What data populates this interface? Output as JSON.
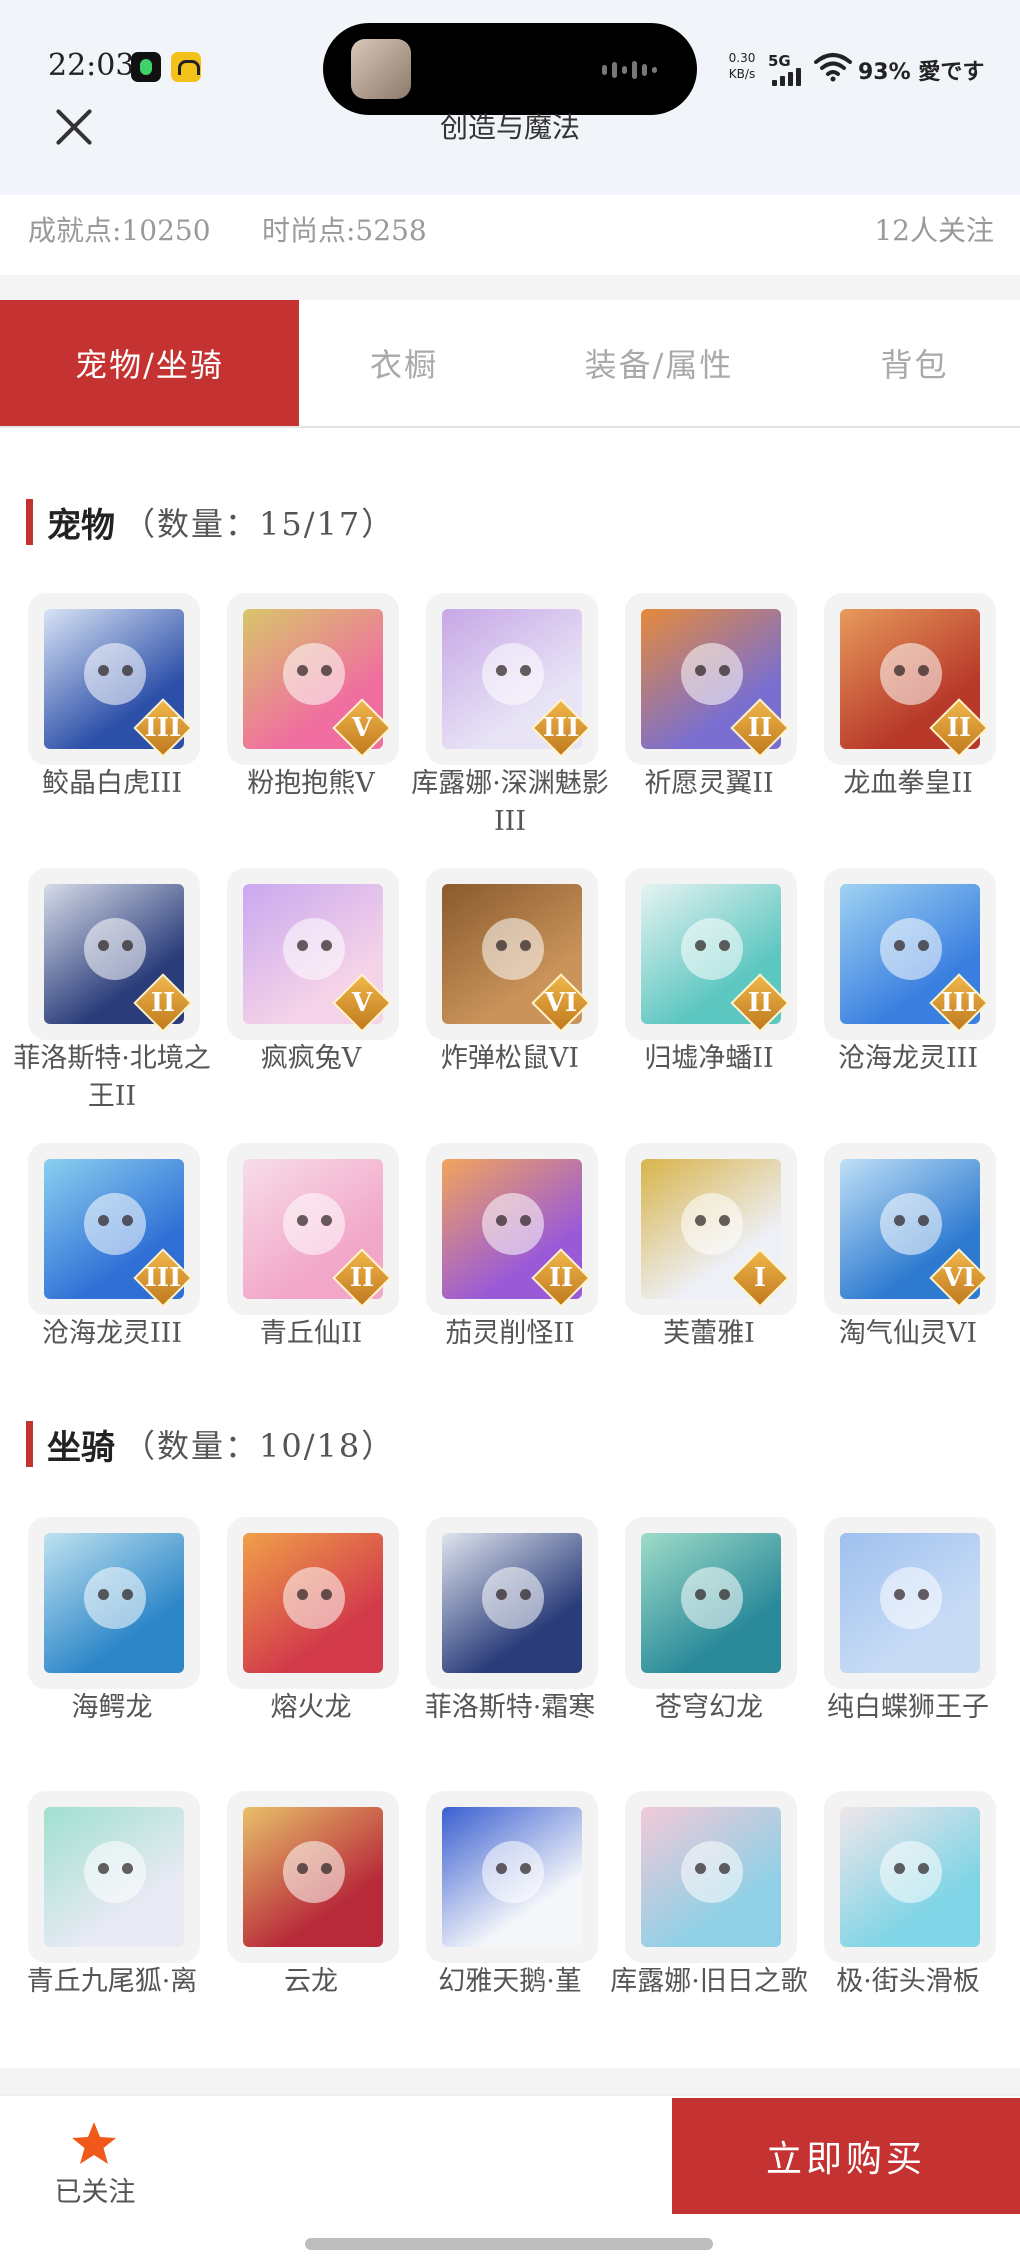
{
  "status_bar": {
    "time": "22:03",
    "net_speed": "0.30 KB/s",
    "network": "5G",
    "battery": "93%",
    "carrier": "愛です"
  },
  "nav": {
    "title": "创造与魔法"
  },
  "stats": {
    "achievement": "成就点:10250",
    "fashion": "时尚点:5258",
    "followers": "12人关注"
  },
  "tabs": [
    {
      "label": "宠物/坐骑",
      "active": true
    },
    {
      "label": "衣橱",
      "active": false
    },
    {
      "label": "装备/属性",
      "active": false
    },
    {
      "label": "背包",
      "active": false
    }
  ],
  "pets": {
    "title": "宠物",
    "count": "（数量：15/17）",
    "items": [
      {
        "name": "鲛晶白虎III",
        "tier": "III",
        "color1": "#2c4fa8",
        "color2": "#d8e3f5"
      },
      {
        "name": "粉抱抱熊V",
        "tier": "V",
        "color1": "#f06da0",
        "color2": "#d8c66a"
      },
      {
        "name": "库露娜·深渊魅影III",
        "tier": "III",
        "color1": "#e8e4f6",
        "color2": "#c7a7e6"
      },
      {
        "name": "祈愿灵翼II",
        "tier": "II",
        "color1": "#7a6fd0",
        "color2": "#e68a3a"
      },
      {
        "name": "龙血拳皇II",
        "tier": "II",
        "color1": "#b8392a",
        "color2": "#e79a5c"
      },
      {
        "name": "菲洛斯特·北境之王II",
        "tier": "II",
        "color1": "#2a3c7a",
        "color2": "#d6dbe8"
      },
      {
        "name": "疯疯兔V",
        "tier": "V",
        "color1": "#f4d2e8",
        "color2": "#c9a8f0"
      },
      {
        "name": "炸弹松鼠VI",
        "tier": "VI",
        "color1": "#c9935a",
        "color2": "#8a5a2e"
      },
      {
        "name": "归墟净蟠II",
        "tier": "II",
        "color1": "#5cc6c0",
        "color2": "#e6f3f2"
      },
      {
        "name": "沧海龙灵III",
        "tier": "III",
        "color1": "#3a7fe0",
        "color2": "#9fd2f2"
      },
      {
        "name": "沧海龙灵III",
        "tier": "III",
        "color1": "#2f6fd6",
        "color2": "#8ad0f0"
      },
      {
        "name": "青丘仙II",
        "tier": "II",
        "color1": "#f2a6c8",
        "color2": "#f7dde9"
      },
      {
        "name": "茄灵削怪II",
        "tier": "II",
        "color1": "#9a5ad8",
        "color2": "#f2a45c"
      },
      {
        "name": "芙蕾雅I",
        "tier": "I",
        "color1": "#eef0f8",
        "color2": "#d8b44a"
      },
      {
        "name": "淘气仙灵VI",
        "tier": "VI",
        "color1": "#2e7ad0",
        "color2": "#bfe0f7"
      }
    ]
  },
  "mounts": {
    "title": "坐骑",
    "count": "（数量：10/18）",
    "items": [
      {
        "name": "海鳄龙",
        "color1": "#2c86c8",
        "color2": "#bfe2f0"
      },
      {
        "name": "熔火龙",
        "color1": "#d23a4a",
        "color2": "#f0a04a"
      },
      {
        "name": "菲洛斯特·霜寒",
        "color1": "#2a3c7a",
        "color2": "#dfe4ee"
      },
      {
        "name": "苍穹幻龙",
        "color1": "#2a8a9a",
        "color2": "#9fdcc8"
      },
      {
        "name": "纯白蝶狮王子",
        "color1": "#c8dcf6",
        "color2": "#9ec0ee"
      },
      {
        "name": "青丘九尾狐·离",
        "color1": "#e9eaf4",
        "color2": "#9fe0d0"
      },
      {
        "name": "云龙",
        "color1": "#b82a3a",
        "color2": "#e8c06a"
      },
      {
        "name": "幻雅天鹅·堇",
        "color1": "#f4f6fa",
        "color2": "#3a5fd0"
      },
      {
        "name": "库露娜·旧日之歌",
        "color1": "#8fd0e6",
        "color2": "#f2c9d8"
      },
      {
        "name": "极·街头滑板",
        "color1": "#7fd4e6",
        "color2": "#f0e6ea"
      }
    ]
  },
  "bottom": {
    "follow_label": "已关注",
    "buy_label": "立即购买"
  }
}
